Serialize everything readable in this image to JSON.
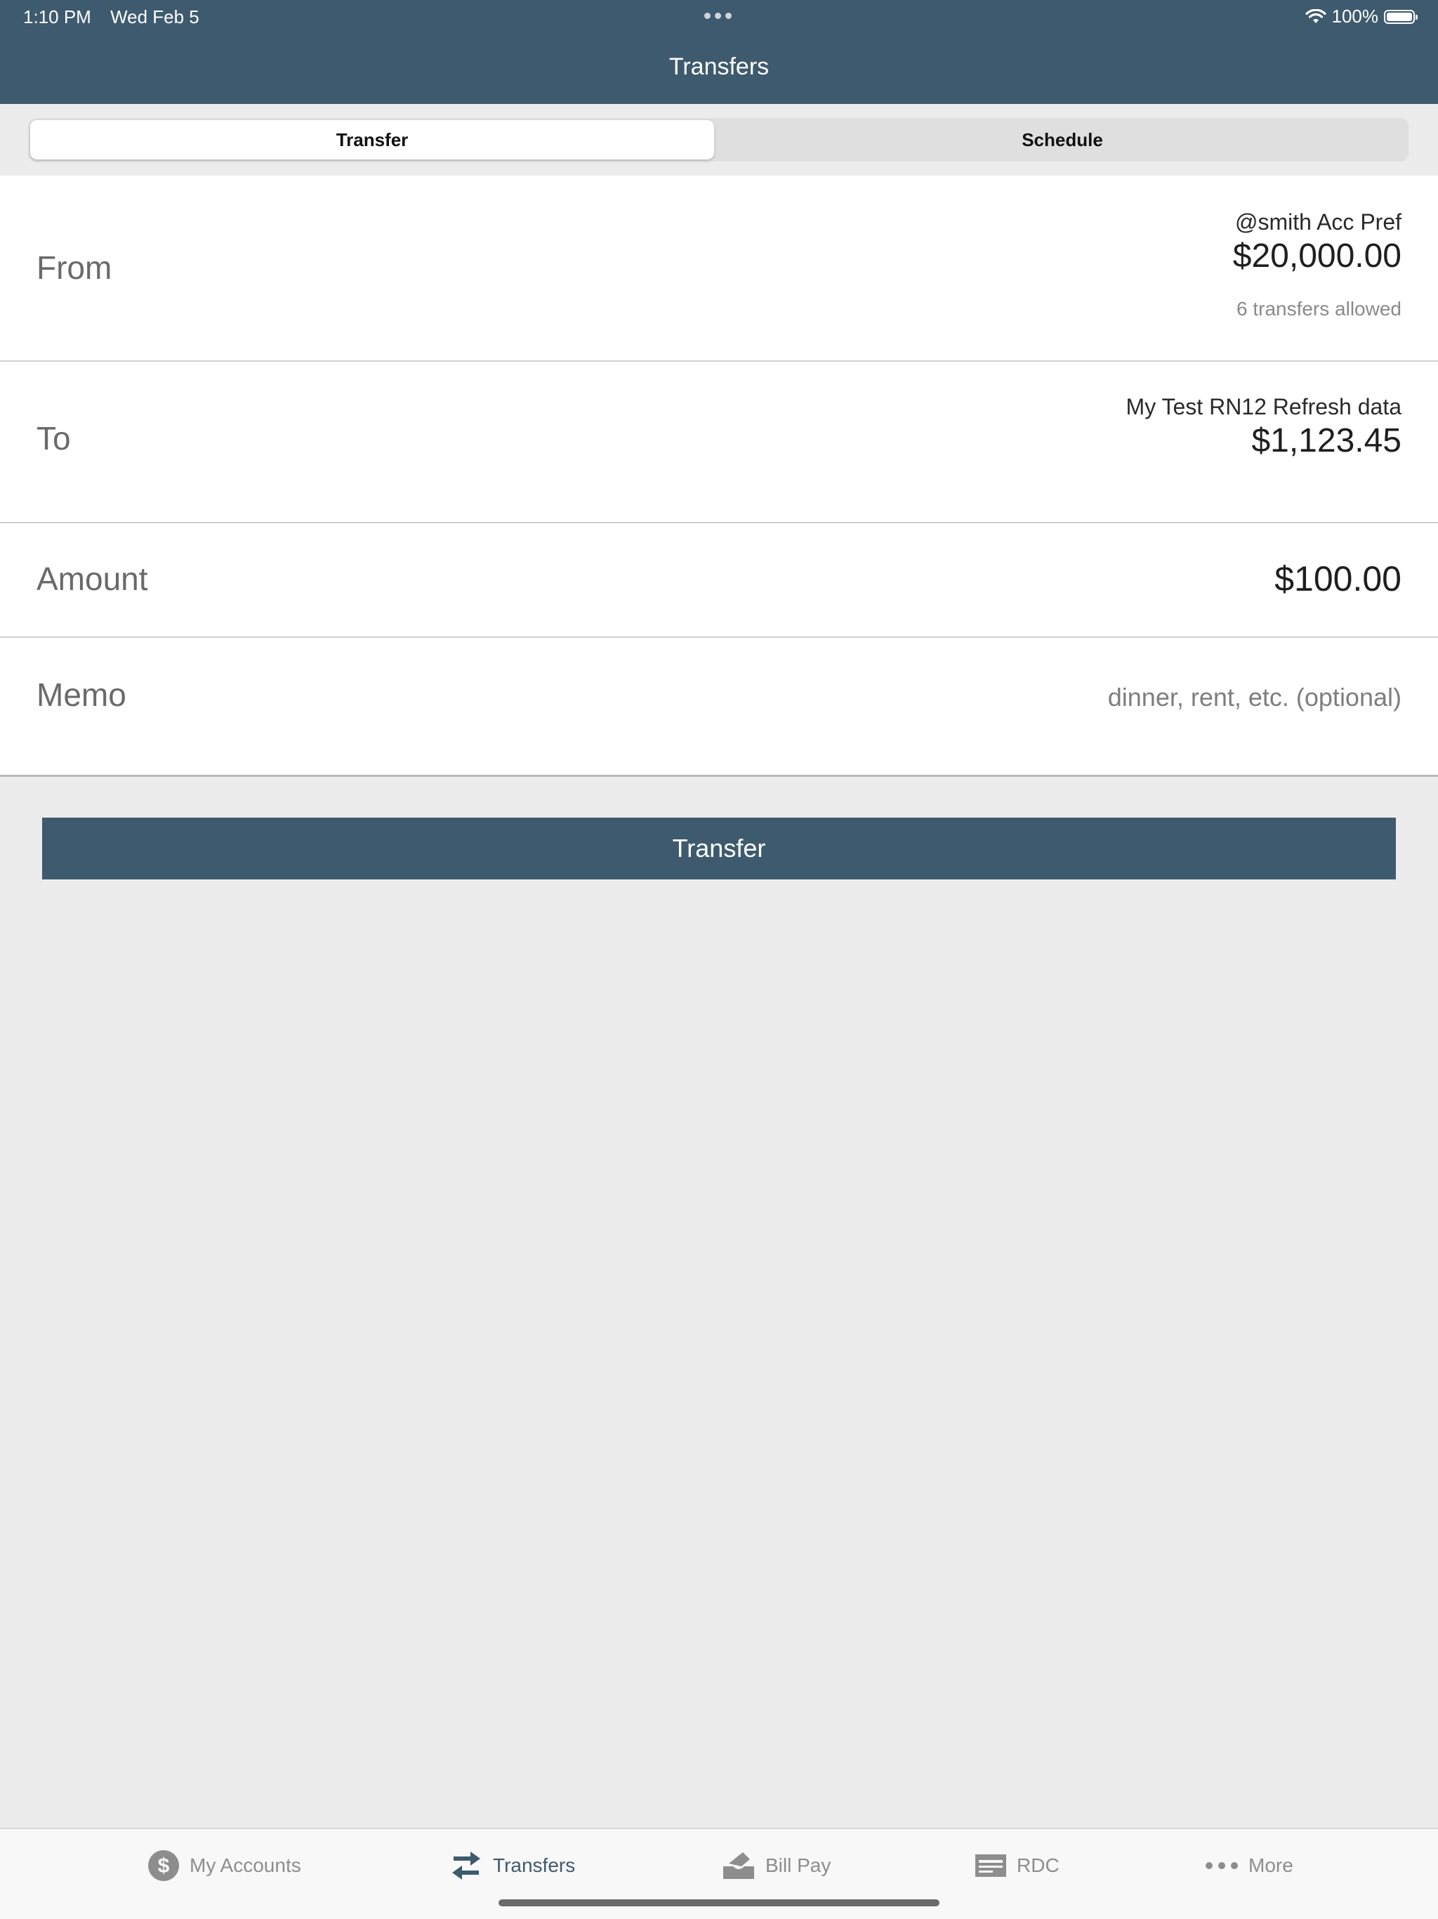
{
  "status_bar": {
    "time": "1:10 PM",
    "date": "Wed Feb 5",
    "battery": "100%"
  },
  "header": {
    "title": "Transfers"
  },
  "segments": {
    "transfer": "Transfer",
    "schedule": "Schedule",
    "selected": "Transfer"
  },
  "form": {
    "from": {
      "label": "From",
      "account_name": "@smith Acc Pref",
      "balance": "$20,000.00",
      "note": "6 transfers allowed"
    },
    "to": {
      "label": "To",
      "account_name": "My Test RN12 Refresh data",
      "balance": "$1,123.45"
    },
    "amount": {
      "label": "Amount",
      "value": "$100.00"
    },
    "memo": {
      "label": "Memo",
      "placeholder": "dinner, rent, etc. (optional)",
      "value": ""
    }
  },
  "submit_label": "Transfer",
  "tabbar": {
    "items": [
      {
        "label": "My Accounts",
        "icon": "dollar-circle-icon"
      },
      {
        "label": "Transfers",
        "icon": "transfer-arrows-icon",
        "active": true
      },
      {
        "label": "Bill Pay",
        "icon": "bill-pay-icon"
      },
      {
        "label": "RDC",
        "icon": "check-card-icon"
      },
      {
        "label": "More",
        "icon": "more-dots-icon"
      }
    ]
  },
  "colors": {
    "brand": "#3e5a6e",
    "background": "#ececed",
    "inactive_tab": "#8d8d8d"
  }
}
